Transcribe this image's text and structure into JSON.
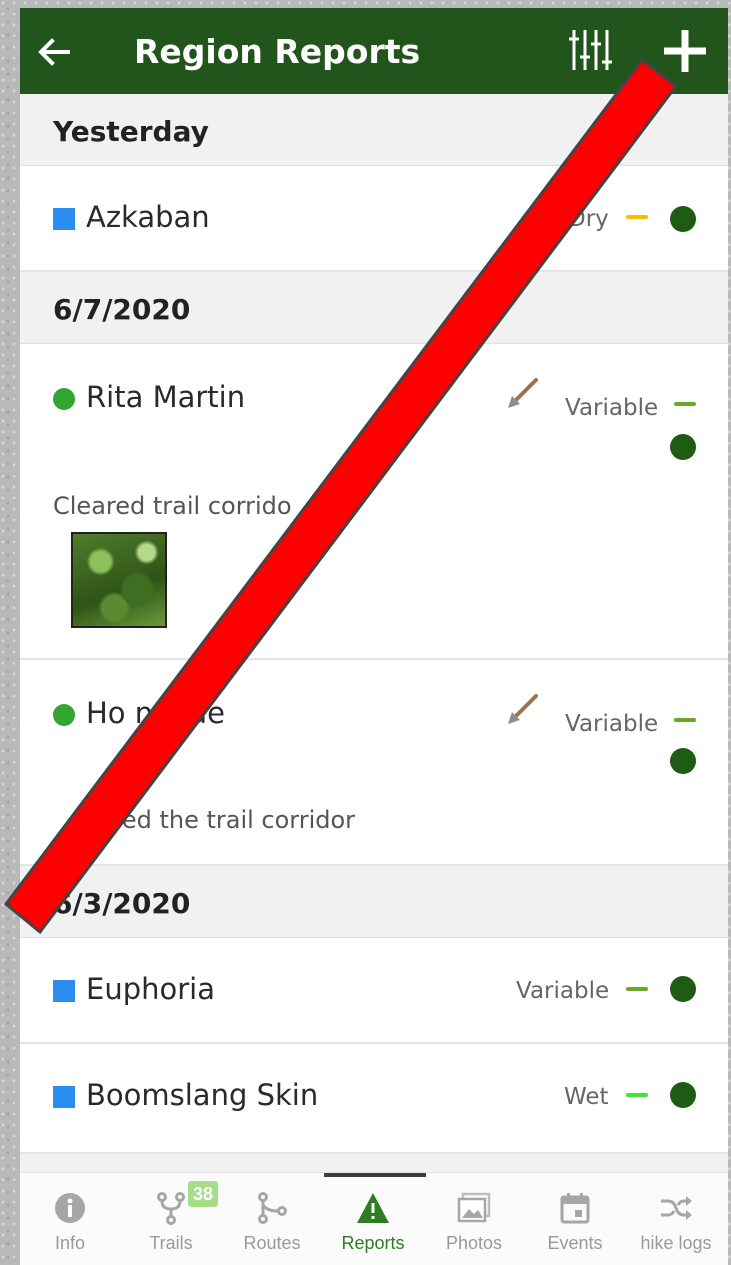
{
  "app_bar": {
    "title": "Region Reports",
    "back_icon": "arrow-left-icon",
    "filter_icon": "sliders-icon",
    "add_icon": "plus-icon"
  },
  "sections": [
    {
      "date": "Yesterday",
      "reports": [
        {
          "type": "trail",
          "name": "Azkaban",
          "condition": "Dry",
          "condition_color": "#f2c200",
          "status_color": "#1d5c12"
        }
      ]
    },
    {
      "date": "6/7/2020",
      "reports": [
        {
          "type": "user",
          "name": "Rita Martin",
          "condition": "Variable",
          "condition_color": "#6aa82b",
          "status_color": "#1d5c12",
          "work_icon": "shovel-icon",
          "description": "Cleared trail corrido",
          "has_photo": true
        },
        {
          "type": "user",
          "name": "Ho      neade",
          "condition": "Variable",
          "condition_color": "#6aa82b",
          "status_color": "#1d5c12",
          "work_icon": "shovel-icon",
          "description": "eared the trail corridor"
        }
      ]
    },
    {
      "date": "6/3/2020",
      "reports": [
        {
          "type": "trail",
          "name": "Euphoria",
          "condition": "Variable",
          "condition_color": "#6aa82b",
          "status_color": "#1d5c12"
        },
        {
          "type": "trail",
          "name": "Boomslang Skin",
          "condition": "Wet",
          "condition_color": "#39e639",
          "status_color": "#1d5c12"
        }
      ]
    }
  ],
  "bottom_nav": {
    "items": [
      {
        "label": "Info",
        "icon": "info-icon"
      },
      {
        "label": "Trails",
        "icon": "trails-icon",
        "badge": "38"
      },
      {
        "label": "Routes",
        "icon": "routes-icon"
      },
      {
        "label": "Reports",
        "icon": "warning-triangle-icon",
        "active": true
      },
      {
        "label": "Photos",
        "icon": "photos-icon"
      },
      {
        "label": "Events",
        "icon": "calendar-icon"
      },
      {
        "label": "hike logs",
        "icon": "shuffle-icon"
      }
    ]
  },
  "colors": {
    "app_bar": "#22551c",
    "accent_active": "#2e7d22",
    "trail_icon": "#2a8ef0",
    "user_icon": "#33a532",
    "overlay_slash": "#ff0000"
  }
}
